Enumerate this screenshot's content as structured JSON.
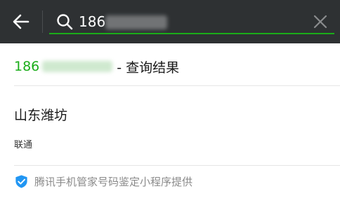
{
  "search": {
    "value": "186",
    "clear_icon": "close-icon",
    "back_icon": "arrow-left-icon",
    "search_icon": "search-icon"
  },
  "result": {
    "number_prefix": "186",
    "title_suffix": "- 查询结果",
    "location": "山东潍坊",
    "carrier": "联通"
  },
  "footer": {
    "provider_text": "腾讯手机管家号码鉴定小程序提供",
    "icon": "shield-check-icon"
  },
  "colors": {
    "header_bg": "#2e3133",
    "accent": "#1aad19",
    "footer_icon": "#2196f3"
  }
}
